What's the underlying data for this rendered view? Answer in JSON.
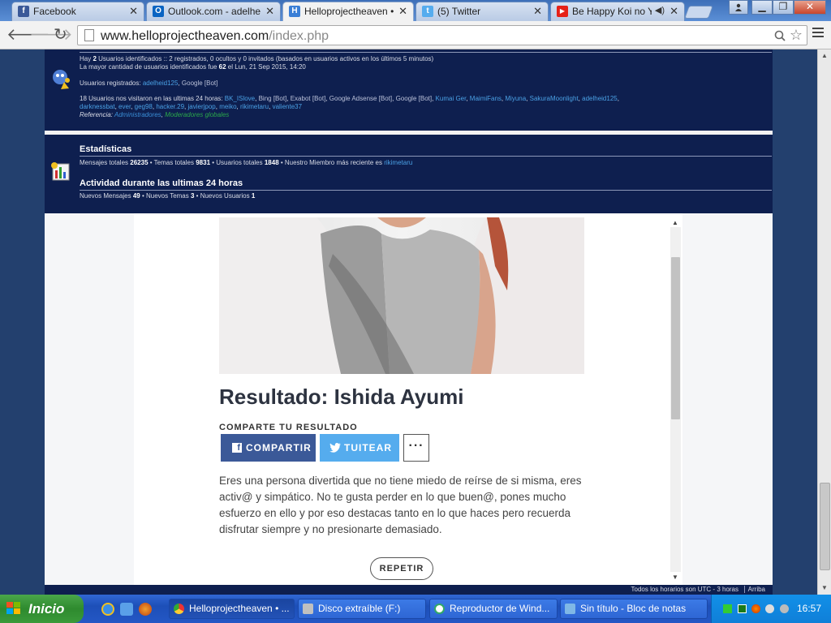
{
  "browser": {
    "tabs": [
      {
        "label": "Facebook",
        "icon": "facebook-icon",
        "color": "#3b5998",
        "glyph": "f"
      },
      {
        "label": "Outlook.com - adelheid",
        "icon": "outlook-icon",
        "color": "#0a64c2",
        "glyph": "O"
      },
      {
        "label": "Helloprojectheaven • P",
        "icon": "helloproject-icon",
        "color": "#3b7fd6",
        "glyph": "H"
      },
      {
        "label": "(5) Twitter",
        "icon": "twitter-icon",
        "color": "#55acee",
        "glyph": "t"
      },
      {
        "label": "Be Happy Koi no Ya",
        "icon": "youtube-icon",
        "color": "#e62117",
        "glyph": "▶"
      }
    ],
    "url_domain": "www.helloprojectheaven.com",
    "url_path": "/index.php"
  },
  "online": {
    "line1_pre": "Hay ",
    "line1_count": "2",
    "line1_post": " Usuarios identificados :: 2 registrados, 0 ocultos y 0 invitados (basados en usuarios activos en los últimos 5 minutos)",
    "line2_pre": "La mayor cantidad de usuarios identificados fue ",
    "line2_count": "62",
    "line2_post": " el Lun, 21 Sep 2015, 14:20",
    "registered_label": "Usuarios registrados:",
    "registered_users": [
      "adelheid125",
      "Google [Bot]"
    ],
    "visited_label": "18 Usuarios nos visitaron en las ultimas 24 horas:",
    "visited_users_line1": [
      "BK_ISlove",
      "Bing [Bot]",
      "Exabot [Bot]",
      "Google Adsense [Bot]",
      "Google [Bot]",
      "Kumai Ger",
      "MaimiFans",
      "Miyuna",
      "SakuraMoonlight",
      "adelheid125"
    ],
    "visited_users_line2": [
      "darknessbat",
      "ever",
      "geg98",
      "hacker.29",
      "javierjpop",
      "meiko",
      "rikimetaru",
      "valiente37"
    ],
    "legend_label": "Referencia:",
    "legend_admins": "Administradores",
    "legend_mods": "Moderadores globales"
  },
  "stats": {
    "title": "Estadísticas",
    "posts_label": "Mensajes totales",
    "posts": "26235",
    "topics_label": "Temas totales",
    "topics": "9831",
    "users_label": "Usuarios totales",
    "users": "1848",
    "newest_label": "Nuestro Miembro más reciente es",
    "newest": "rikimetaru",
    "activity_title": "Actividad durante las ultimas 24 horas",
    "new_posts_label": "Nuevos Mensajes",
    "new_posts": "49",
    "new_topics_label": "Nuevos Temas",
    "new_topics": "3",
    "new_users_label": "Nuevos Usuarios",
    "new_users": "1"
  },
  "quiz": {
    "result_title": "Resultado: Ishida Ayumi",
    "share_label": "COMPARTE TU RESULTADO",
    "facebook_label": "COMPARTIR",
    "twitter_label": "TUITEAR",
    "more_label": "···",
    "result_text": "Eres una persona divertida que no tiene miedo de reírse de si misma, eres activ@  y simpático. No te gusta perder en lo que buen@, pones mucho esfuerzo en ello y por eso destacas tanto en lo que haces pero recuerda disfrutar siempre y no presionarte demasiado.",
    "repeat_label": "REPETIR"
  },
  "footer": {
    "timezone": "Todos los horarios son UTC - 3 horas",
    "top_link": "Arriba"
  },
  "taskbar": {
    "start_label": "Inicio",
    "tasks": [
      {
        "label": "Helloprojectheaven • ...",
        "icon": "chrome-icon",
        "color": "#e8b020"
      },
      {
        "label": "Disco extraíble (F:)",
        "icon": "drive-icon",
        "color": "#c0c0c0"
      },
      {
        "label": "Reproductor de Wind...",
        "icon": "media-player-icon",
        "color": "#f0f0f0"
      },
      {
        "label": "Sin título - Bloc de notas",
        "icon": "notepad-icon",
        "color": "#7fb8e6"
      }
    ],
    "clock": "16:57"
  }
}
